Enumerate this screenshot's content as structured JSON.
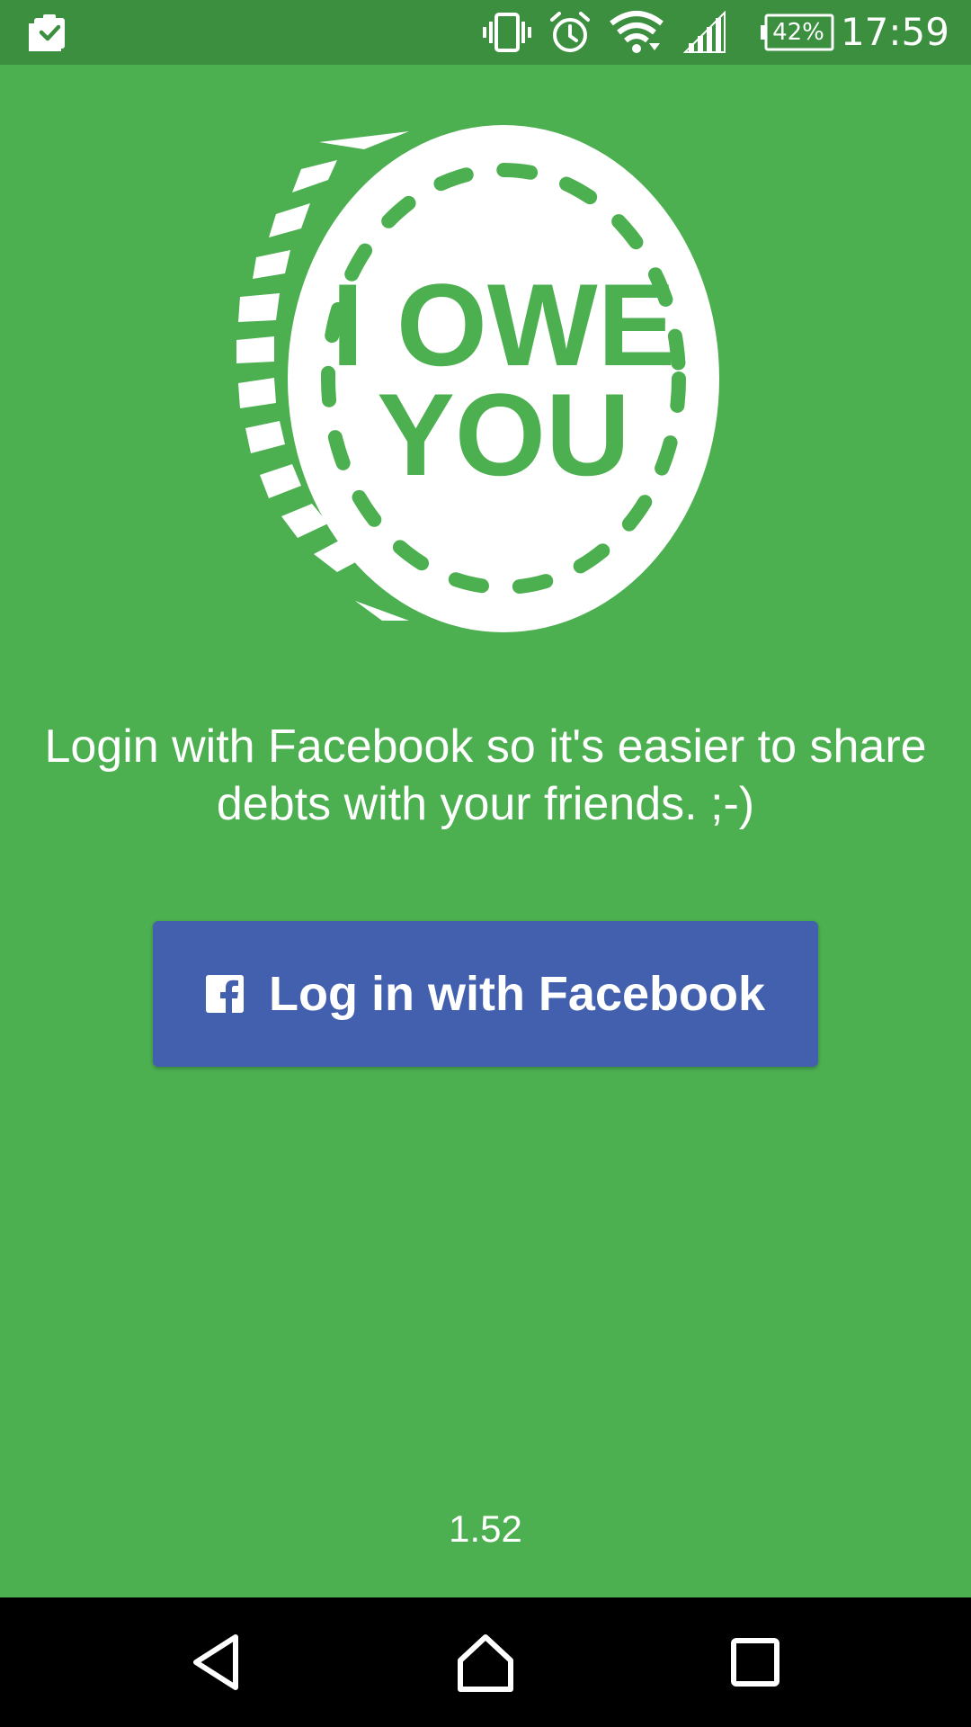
{
  "status_bar": {
    "notification_icon": "clipboard-check-icon",
    "icons": [
      "vibrate-icon",
      "alarm-icon",
      "wifi-icon",
      "signal-icon",
      "battery-icon"
    ],
    "battery_percent": "42%",
    "time": "17:59"
  },
  "logo": {
    "line1": "I OWE",
    "line2": "YOU"
  },
  "login": {
    "tagline": "Login with Facebook so it's easier to share debts with your friends. ;-)",
    "button_label": "Log in with Facebook",
    "button_icon": "facebook-icon"
  },
  "footer": {
    "version": "1.52"
  },
  "nav_bar": {
    "back": "back-icon",
    "home": "home-icon",
    "recents": "recents-icon"
  },
  "colors": {
    "background": "#4caf50",
    "status_bar": "#3b8f3f",
    "facebook_button": "#4360ae",
    "nav_bar": "#000000"
  }
}
